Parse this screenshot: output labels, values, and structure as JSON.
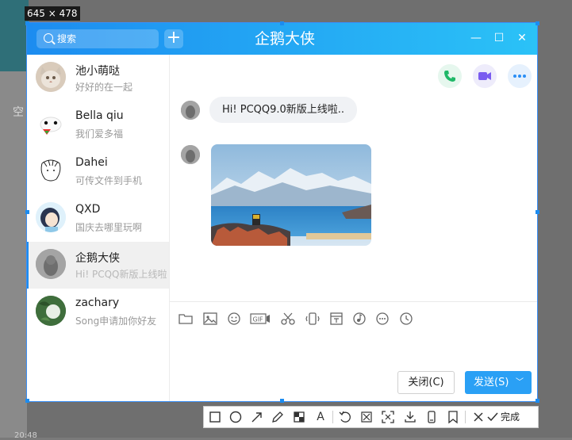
{
  "size_label": "645 × 478",
  "background": {
    "left_char": "空",
    "bottom_text": "20:48"
  },
  "window": {
    "title": "企鹅大侠",
    "search_placeholder": "搜索",
    "add_button": "+",
    "controls": {
      "minimize": "—",
      "maximize": "☐",
      "close": "✕"
    }
  },
  "contacts": [
    {
      "name": "池小萌哒",
      "message": "好好的在一起",
      "avatar": "cat-avatar"
    },
    {
      "name": "Bella qiu",
      "message": "我们爱多福",
      "avatar": "panda-avatar"
    },
    {
      "name": "Dahei",
      "message": "可传文件到手机",
      "avatar": "sketch-avatar"
    },
    {
      "name": "QXD",
      "message": "国庆去哪里玩啊",
      "avatar": "girl-avatar"
    },
    {
      "name": "企鹅大侠",
      "message": "Hi! PCQQ新版上线啦",
      "avatar": "gray-avatar",
      "active": true
    },
    {
      "name": "zachary",
      "message": "Song申请加你好友",
      "avatar": "nature-avatar"
    }
  ],
  "chat": {
    "message_text": "Hi!  PCQQ9.0新版上线啦..",
    "top_icons": [
      "phone-icon",
      "video-icon",
      "more-icon"
    ],
    "toolbar_icons": [
      "folder-icon",
      "image-icon",
      "emoji-icon",
      "gif-icon",
      "scissors-icon",
      "shake-icon",
      "calendar-icon",
      "music-icon",
      "more-circle-icon",
      "clock-icon"
    ],
    "gif_label": "GIF",
    "close_label": "关闭(C)",
    "send_label": "发送(S)",
    "send_arrow": "﹀"
  },
  "screenshot_toolbar": {
    "tools": [
      "rectangle-icon",
      "circle-icon",
      "arrow-icon",
      "pencil-icon",
      "mosaic-icon",
      "text-icon",
      "undo-icon",
      "pin-icon",
      "ocr-icon",
      "download-icon",
      "phone-save-icon",
      "bookmark-icon",
      "cancel-icon",
      "check-icon"
    ],
    "text_glyph": "A",
    "done_label": "完成"
  },
  "colors": {
    "accent": "#1c8cf0",
    "send": "#2aa0f5",
    "title_gradient_end": "#2bc2f7"
  }
}
